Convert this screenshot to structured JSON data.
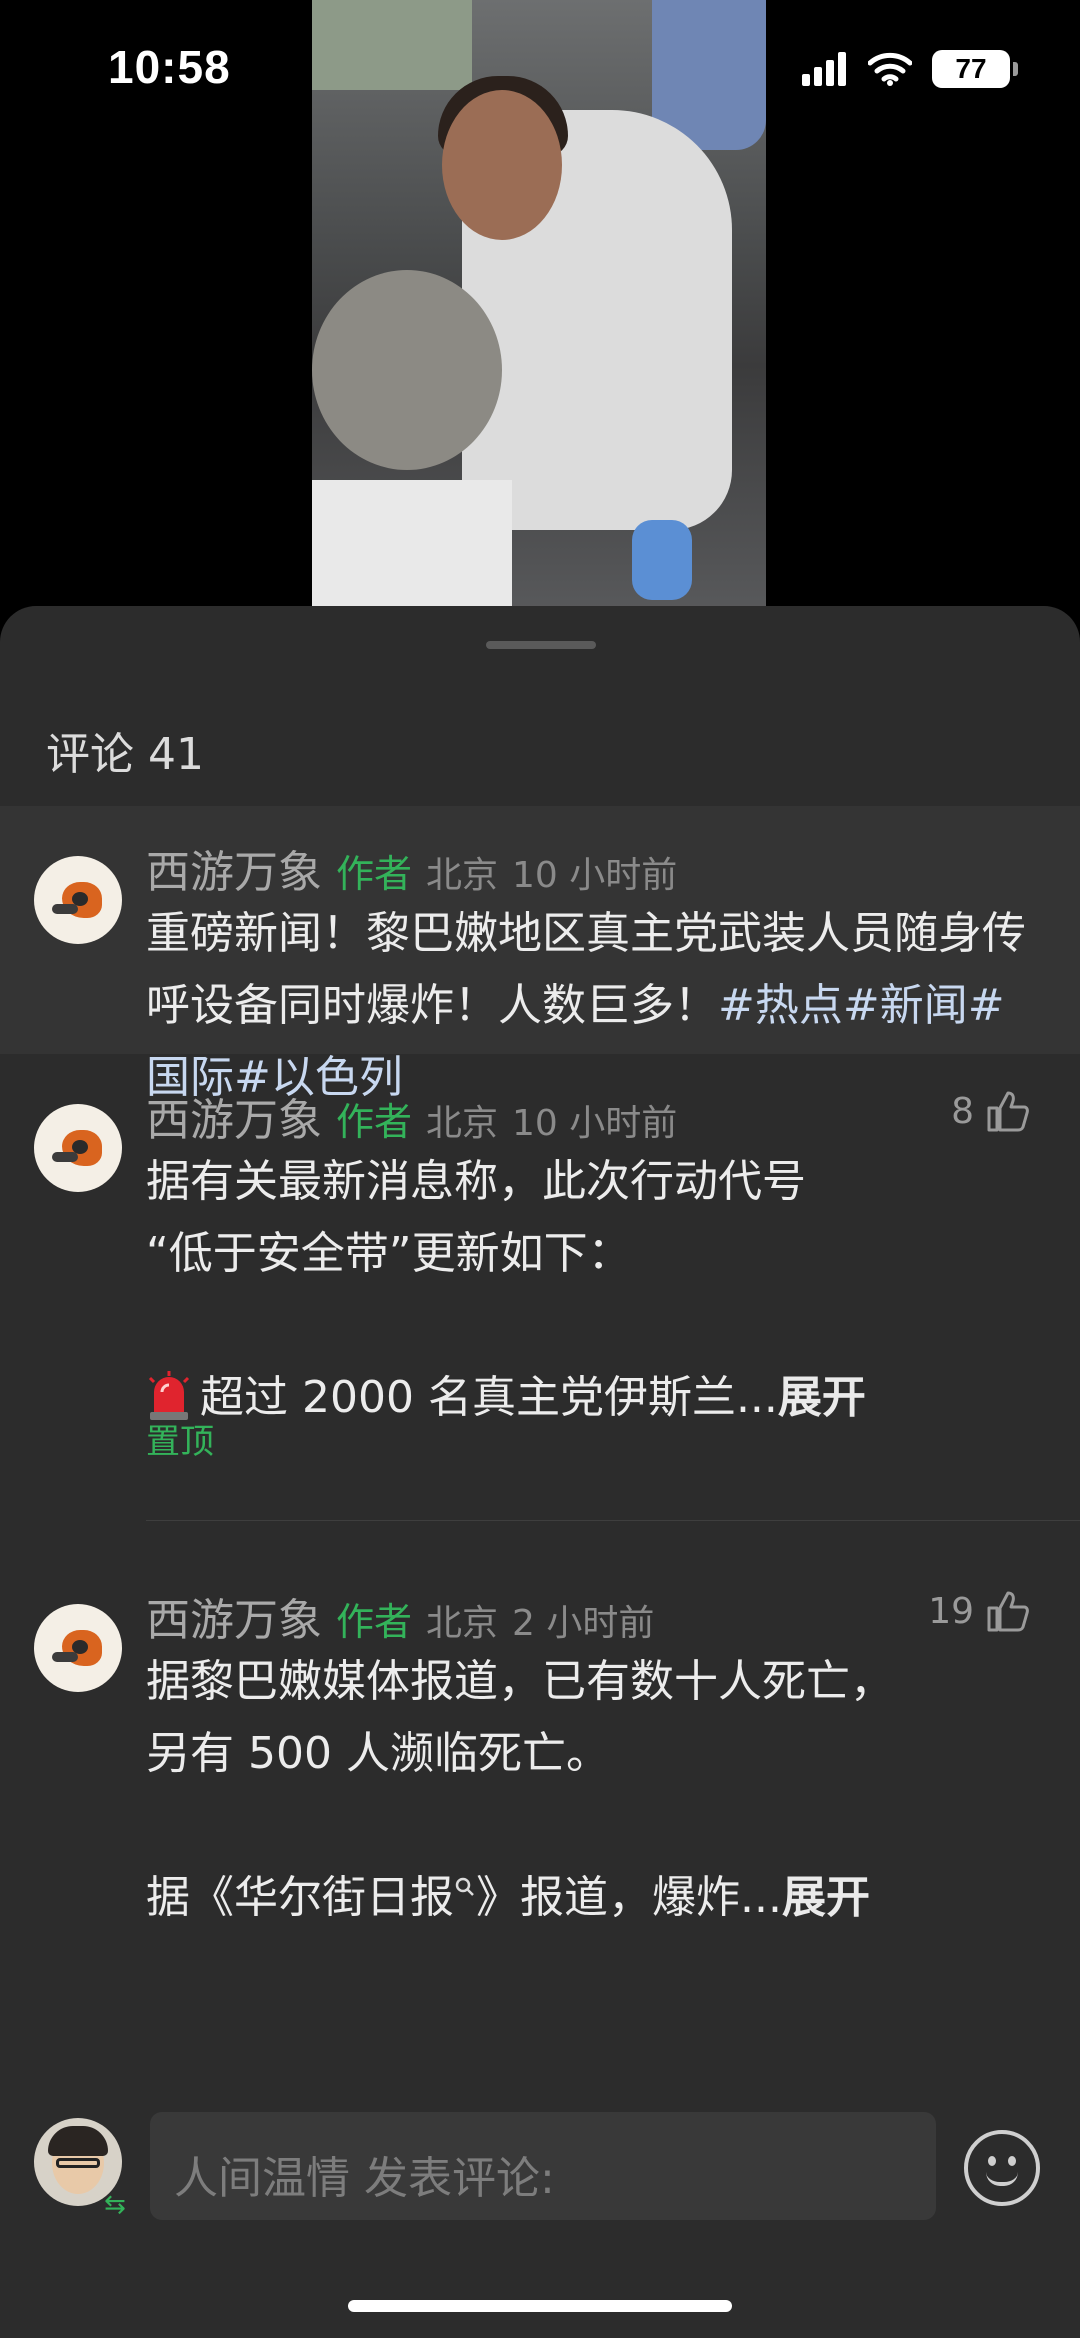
{
  "status": {
    "time": "10:58",
    "battery": "77"
  },
  "sheet": {
    "title": "评论 41"
  },
  "comments": [
    {
      "name": "西游万象",
      "tag": "作者",
      "location": "北京",
      "time": "10 小时前",
      "text": "重磅新闻！黎巴嫩地区真主党武装人员随身传呼设备同时爆炸！人数巨多！",
      "hashtags": "#热点#新闻#国际#以色列"
    },
    {
      "name": "西游万象",
      "tag": "作者",
      "location": "北京",
      "time": "10 小时前",
      "likes": "8",
      "line1": "据有关最新消息称，此次行动代号",
      "line2": "“低于安全带”更新如下：",
      "line3": "超过 2000 名真主党伊斯兰...",
      "expand": "展开",
      "pinned": "置顶"
    },
    {
      "name": "西游万象",
      "tag": "作者",
      "location": "北京",
      "time": "2 小时前",
      "likes": "19",
      "line1": "据黎巴嫩媒体报道，已有数十人死亡，",
      "line2": "另有 500 人濒临死亡。",
      "line3": "据《华尔街日报",
      "line3b": "》报道，爆炸...",
      "expand": "展开"
    }
  ],
  "input": {
    "placeholder": "人间温情 发表评论:"
  },
  "icons": {
    "signal": "signal-icon",
    "wifi": "wifi-icon",
    "like": "thumb-up-icon",
    "search": "search-icon",
    "emoji": "emoji-icon",
    "alarm": "siren-emoji",
    "swap": "swap-icon"
  },
  "colors": {
    "accent_green": "#33b35a",
    "sheet_bg": "#2c2c2c"
  }
}
